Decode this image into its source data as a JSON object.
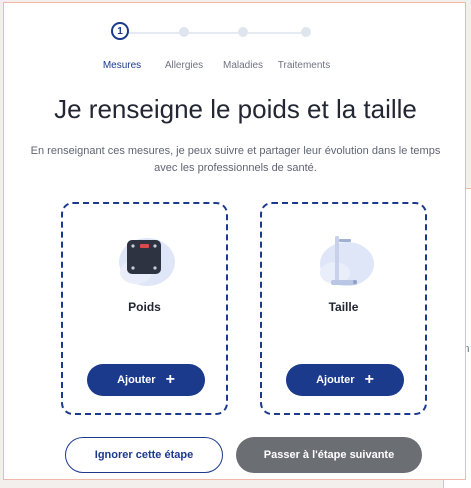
{
  "stepper": {
    "current_step_number": "1",
    "steps": [
      {
        "label": "Mesures",
        "active": true
      },
      {
        "label": "Allergies",
        "active": false
      },
      {
        "label": "Maladies",
        "active": false
      },
      {
        "label": "Traitements",
        "active": false
      }
    ]
  },
  "header": {
    "title": "Je renseigne le poids et la taille",
    "subtitle": "En renseignant ces mesures, je peux suivre et partager leur évolution dans le temps avec les professionnels de santé."
  },
  "cards": [
    {
      "label": "Poids",
      "icon": "scale-icon",
      "button_label": "Ajouter",
      "button_icon": "+"
    },
    {
      "label": "Taille",
      "icon": "height-gauge-icon",
      "button_label": "Ajouter",
      "button_icon": "+"
    }
  ],
  "footer": {
    "skip_label": "Ignorer cette étape",
    "next_label": "Passer à l'étape suivante"
  },
  "background_panel": {
    "text": "En"
  },
  "colors": {
    "primary": "#1c3a8c",
    "disabled": "#6b6e73",
    "frame_border": "#f1b7a8"
  }
}
